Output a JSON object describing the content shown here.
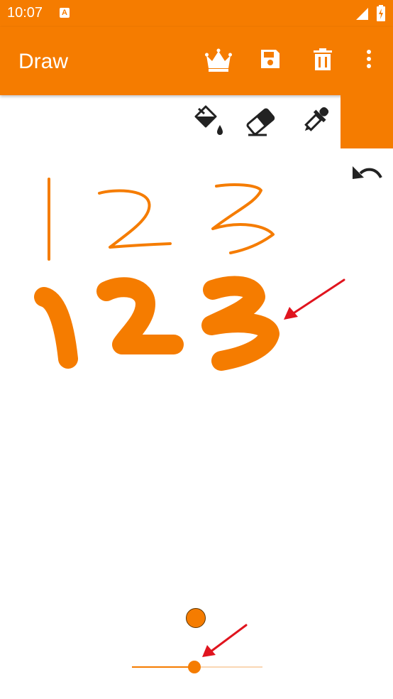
{
  "status_bar": {
    "time": "10:07",
    "notification_letter": "A"
  },
  "app_bar": {
    "title": "Draw",
    "actions": [
      "crown-icon",
      "save-icon",
      "delete-icon",
      "more-vert-icon"
    ]
  },
  "tools": [
    "fill-bucket-icon",
    "eraser-icon",
    "eyedropper-icon"
  ],
  "colors": {
    "primary": "#f57c00",
    "stroke": "#f57c00",
    "slider_inactive": "#fad7b3",
    "annotation_arrow": "#e0141e"
  },
  "brush": {
    "size_fraction": 0.48
  }
}
